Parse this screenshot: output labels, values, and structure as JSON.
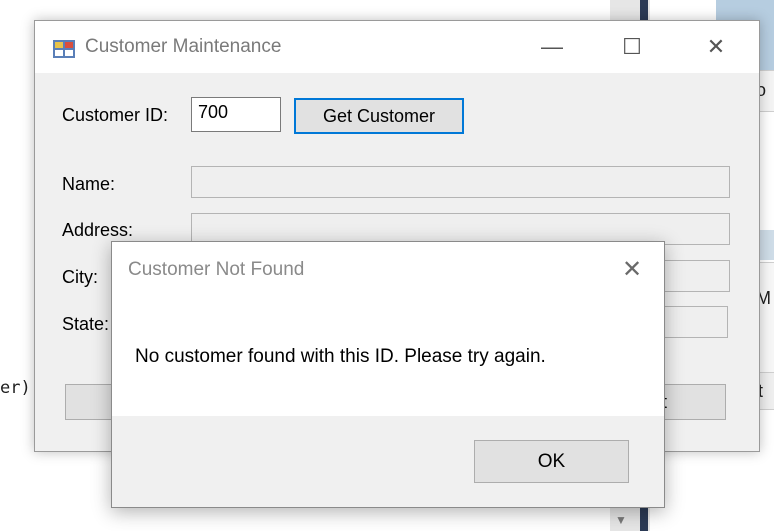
{
  "background": {
    "code_fragment": "er)",
    "right_fragments": [
      "o",
      "M",
      "t"
    ],
    "scroll_arrow": "▼"
  },
  "main_window": {
    "title": "Customer Maintenance",
    "controls": {
      "minimize": "—",
      "maximize": "☐",
      "close": "✕"
    },
    "customer_id_label": "Customer ID:",
    "customer_id_value": "700",
    "get_customer_button": "Get Customer",
    "name_label": "Name:",
    "address_label": "Address:",
    "city_label": "City:",
    "state_label": "State:",
    "bottom_left_fragment": "",
    "exit_fragment": "it"
  },
  "dialog": {
    "title": "Customer Not Found",
    "close": "✕",
    "message": "No customer found with this ID. Please try again.",
    "ok_button": "OK"
  }
}
